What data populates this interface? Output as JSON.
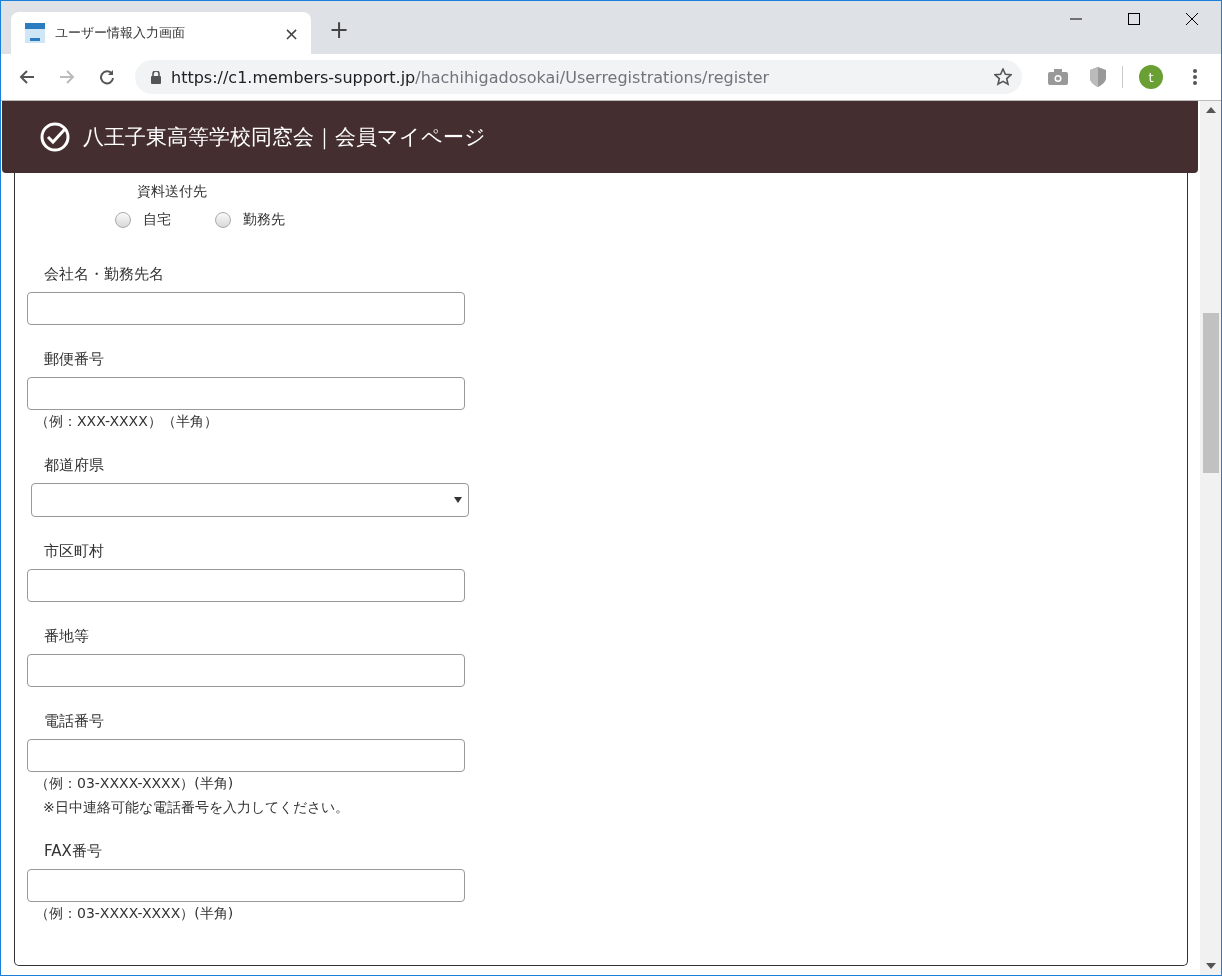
{
  "browser": {
    "tab": {
      "title": "ユーザー情報入力画面",
      "close": "×"
    },
    "new_tab": "+",
    "url": {
      "host": "https://c1.members-support.jp",
      "path": "/hachihigadosokai/Userregistrations/register"
    },
    "avatar": "t"
  },
  "header": {
    "title": "八王子東高等学校同窓会｜会員マイページ"
  },
  "delivery": {
    "label": "資料送付先",
    "options": [
      {
        "label": "自宅",
        "selected": false
      },
      {
        "label": "勤務先",
        "selected": false
      }
    ]
  },
  "fields": [
    {
      "kind": "text",
      "label": "会社名・勤務先名"
    },
    {
      "kind": "text",
      "label": "郵便番号",
      "hints": [
        {
          "kind": "example",
          "text": "（例：XXX-XXXX）（半角）"
        }
      ]
    },
    {
      "kind": "select",
      "label": "都道府県"
    },
    {
      "kind": "text",
      "label": "市区町村"
    },
    {
      "kind": "text",
      "label": "番地等"
    },
    {
      "kind": "text",
      "label": "電話番号",
      "hints": [
        {
          "kind": "example",
          "text": "（例：03-XXXX-XXXX）(半角)"
        },
        {
          "kind": "note",
          "text": "※日中連絡可能な電話番号を入力してください。"
        }
      ]
    },
    {
      "kind": "text",
      "label": "FAX番号",
      "hints": [
        {
          "kind": "example",
          "text": "（例：03-XXXX-XXXX）(半角)"
        }
      ]
    }
  ]
}
